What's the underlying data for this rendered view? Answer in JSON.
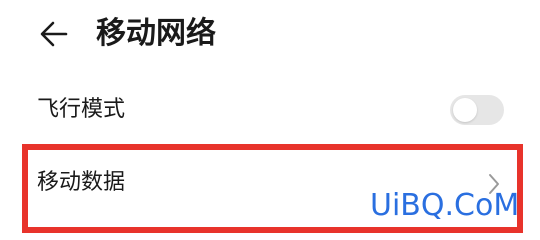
{
  "header": {
    "back_icon": "arrow-left-icon",
    "title": "移动网络"
  },
  "settings": {
    "airplane_mode": {
      "label": "飞行模式",
      "enabled": false
    },
    "mobile_data": {
      "label": "移动数据",
      "icon": "chevron-right-icon"
    }
  },
  "annotation": {
    "highlight_color": "#e8332b"
  },
  "watermark": {
    "text": "UiBQ.CoM",
    "color": "#2a6fe0"
  }
}
